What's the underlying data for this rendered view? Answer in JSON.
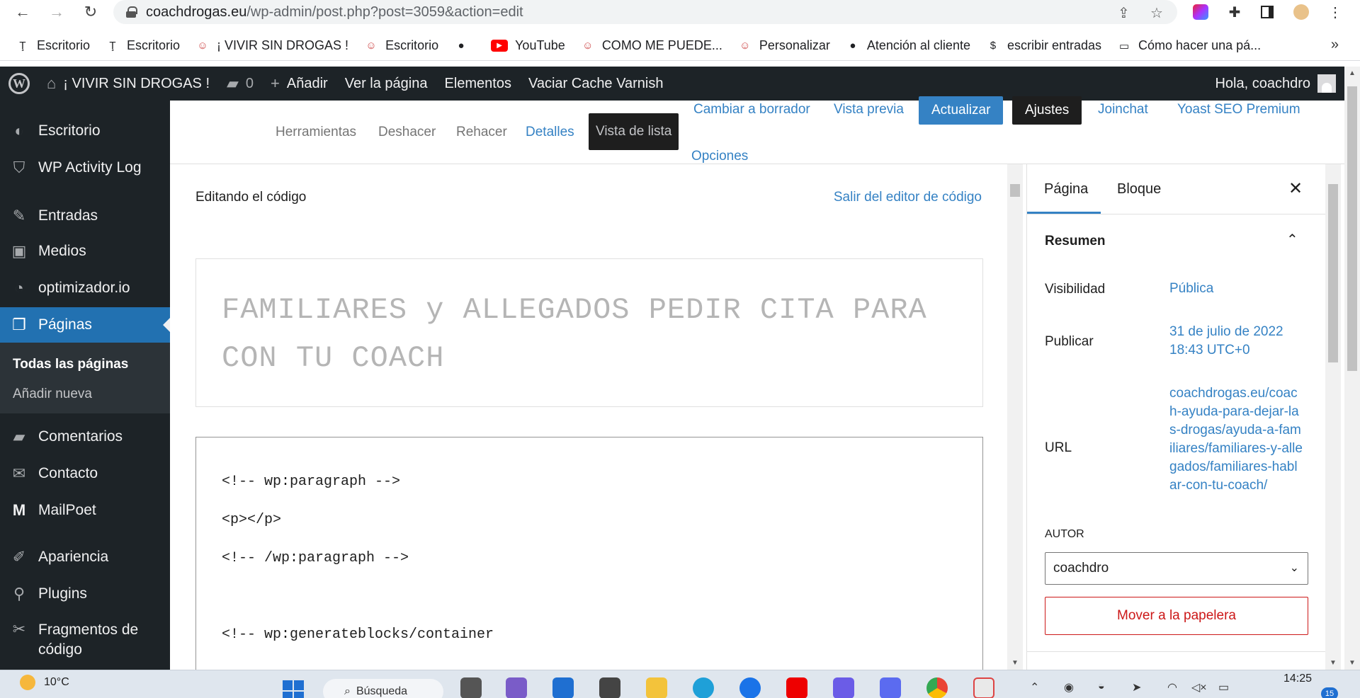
{
  "browser": {
    "url_host": "coachdrogas.eu",
    "url_path": "/wp-admin/post.php?post=3059&action=edit",
    "bookmarks": [
      {
        "label": "Escritorio",
        "icon": "wp-pin-icon"
      },
      {
        "label": "Escritorio",
        "icon": "wp-pin-icon"
      },
      {
        "label": "¡ VIVIR SIN DROGAS !",
        "icon": "site-favicon"
      },
      {
        "label": "Escritorio",
        "icon": "site-favicon"
      },
      {
        "label": "",
        "icon": "globe-icon"
      },
      {
        "label": "YouTube",
        "icon": "youtube-icon"
      },
      {
        "label": "COMO ME PUEDE...",
        "icon": "site-favicon"
      },
      {
        "label": "Personalizar",
        "icon": "site-favicon"
      },
      {
        "label": "Atención al cliente",
        "icon": "globe-icon"
      },
      {
        "label": "escribir entradas",
        "icon": "dollar-icon"
      },
      {
        "label": "Cómo hacer una pá...",
        "icon": "laptop-icon"
      }
    ],
    "more": "»"
  },
  "adminbar": {
    "site_name": "¡ VIVIR SIN DROGAS !",
    "comments_count": "0",
    "add_new": "Añadir",
    "view_page": "Ver la página",
    "elements": "Elementos",
    "purge": "Vaciar Cache Varnish",
    "greeting": "Hola, coachdro"
  },
  "sidebar": {
    "items": [
      {
        "label": "Escritorio",
        "icon": "dashboard-icon"
      },
      {
        "label": "WP Activity Log",
        "icon": "shield-icon"
      },
      {
        "label": "Entradas",
        "icon": "pin-icon"
      },
      {
        "label": "Medios",
        "icon": "media-icon"
      },
      {
        "label": "optimizador.io",
        "icon": "gauge-icon"
      },
      {
        "label": "Páginas",
        "icon": "pages-icon"
      },
      {
        "label": "Comentarios",
        "icon": "comment-icon"
      },
      {
        "label": "Contacto",
        "icon": "mail-icon"
      },
      {
        "label": "MailPoet",
        "icon": "mailpoet-icon"
      },
      {
        "label": "Apariencia",
        "icon": "brush-icon"
      },
      {
        "label": "Plugins",
        "icon": "plugin-icon"
      },
      {
        "label": "Fragmentos de código",
        "icon": "scissors-icon"
      }
    ],
    "submenu": [
      "Todas las páginas",
      "Añadir nueva"
    ]
  },
  "editor_header": {
    "tools": "Herramientas",
    "undo": "Deshacer",
    "redo": "Rehacer",
    "details": "Detalles",
    "list_view": "Vista de lista",
    "draft": "Cambiar a borrador",
    "preview": "Vista previa",
    "update": "Actualizar",
    "settings": "Ajustes",
    "joinchat": "Joinchat",
    "yoast": "Yoast SEO Premium",
    "options": "Opciones"
  },
  "code_editor": {
    "title": "Editando el código",
    "exit": "Salir del editor de código",
    "post_title": "FAMILIARES y ALLEGADOS PEDIR CITA PARA CON TU COACH",
    "lines": [
      "<!-- wp:paragraph -->",
      "<p></p>",
      "<!-- /wp:paragraph -->",
      "",
      "<!-- wp:generateblocks/container"
    ]
  },
  "settings": {
    "tab_page": "Página",
    "tab_block": "Bloque",
    "summary": "Resumen",
    "visibility_label": "Visibilidad",
    "visibility_value": "Pública",
    "publish_label": "Publicar",
    "publish_value": "31 de julio de 2022 18:43 UTC+0",
    "url_label": "URL",
    "url_value": "coachdrogas.eu/coach-ayuda-para-dejar-las-drogas/ayuda-a-familiares/familiares-y-allegados/familiares-hablar-con-tu-coach/",
    "author_label": "AUTOR",
    "author_value": "coachdro",
    "trash": "Mover a la papelera"
  },
  "taskbar": {
    "temperature": "10°C",
    "search": "Búsqueda",
    "time": "14:25",
    "notifications": "15"
  },
  "colors": {
    "wp_dark": "#1d2327",
    "wp_blue": "#2271b1",
    "link_blue": "#3582c4",
    "danger": "#cc1818"
  }
}
